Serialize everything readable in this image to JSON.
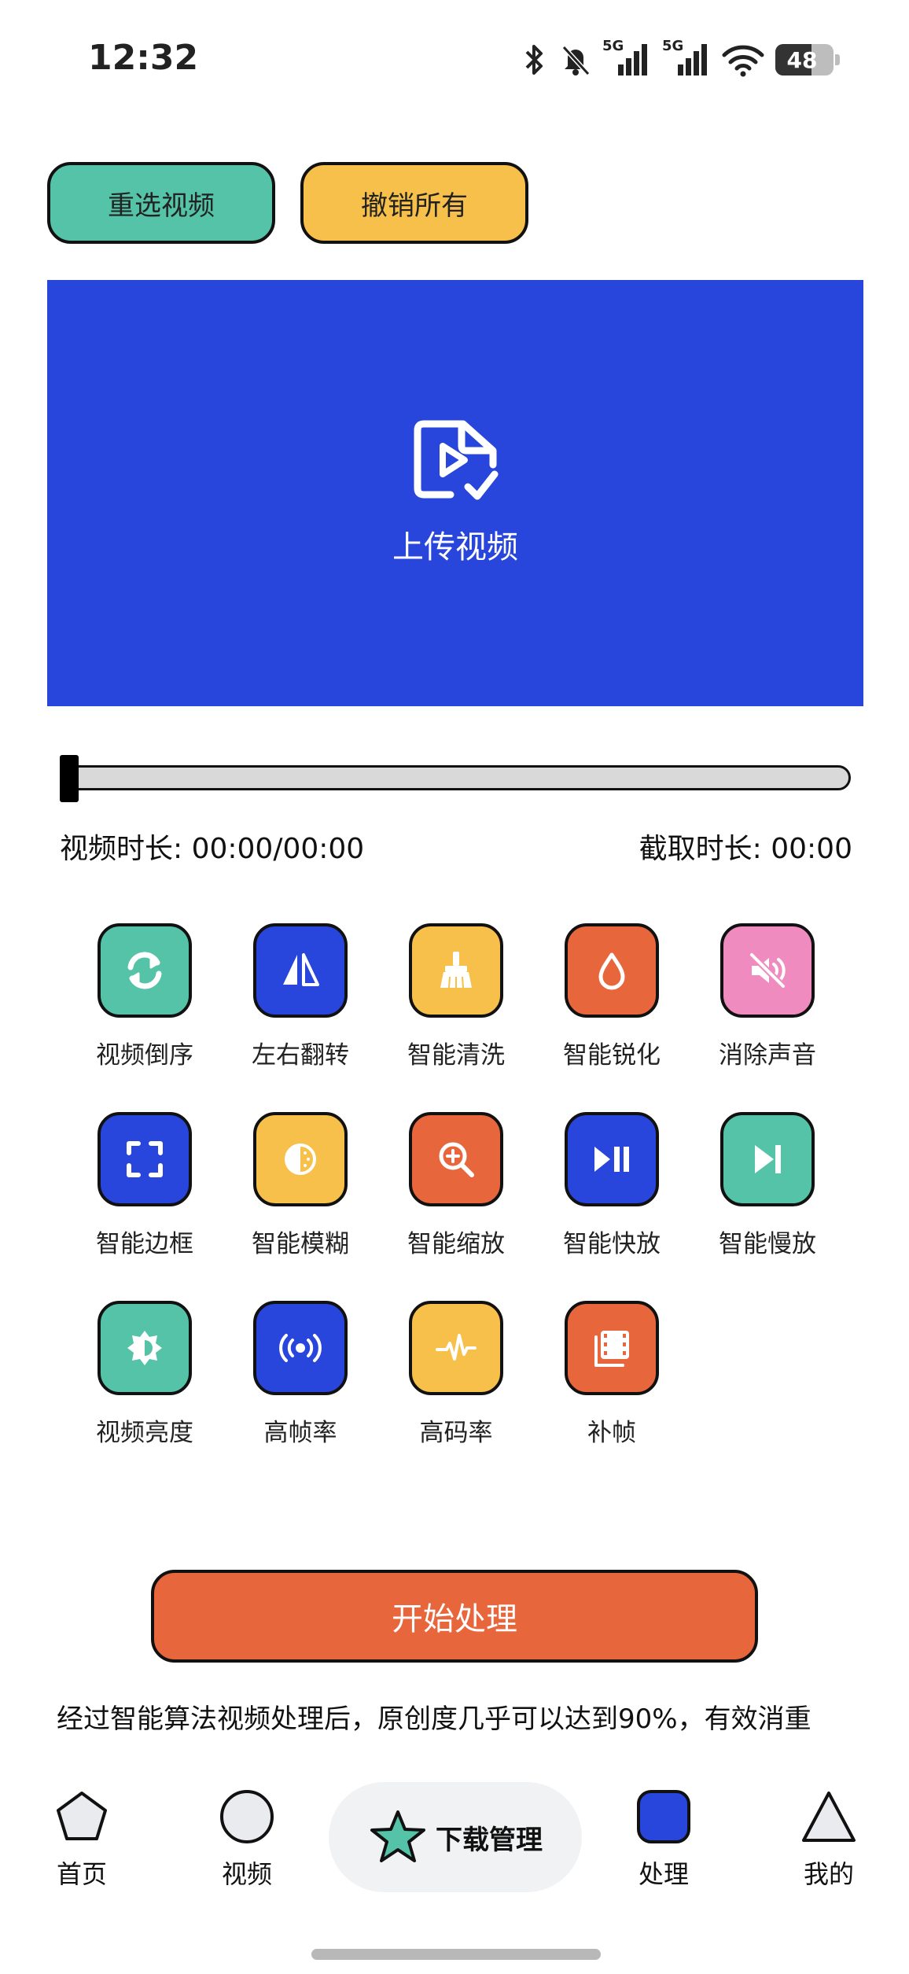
{
  "status_bar": {
    "time": "12:32",
    "battery": "48",
    "network_1": "5G",
    "network_2": "5G"
  },
  "actions": {
    "reselect": "重选视频",
    "undo_all": "撤销所有"
  },
  "upload": {
    "label": "上传视频"
  },
  "slider": {
    "position": 0
  },
  "duration": {
    "video": "视频时长: 00:00/00:00",
    "clip": "截取时长: 00:00"
  },
  "tools": [
    {
      "label": "视频倒序",
      "icon": "refresh-icon",
      "color": "#55c3a7"
    },
    {
      "label": "左右翻转",
      "icon": "flip-icon",
      "color": "#2845dc"
    },
    {
      "label": "智能清洗",
      "icon": "broom-icon",
      "color": "#f7c04a"
    },
    {
      "label": "智能锐化",
      "icon": "drop-icon",
      "color": "#e8663c"
    },
    {
      "label": "消除声音",
      "icon": "mute-icon",
      "color": "#f08bc0"
    },
    {
      "label": "智能边框",
      "icon": "frame-icon",
      "color": "#2845dc"
    },
    {
      "label": "智能模糊",
      "icon": "blur-icon",
      "color": "#f7c04a"
    },
    {
      "label": "智能缩放",
      "icon": "zoom-icon",
      "color": "#e8663c"
    },
    {
      "label": "智能快放",
      "icon": "play-pause-icon",
      "color": "#2845dc"
    },
    {
      "label": "智能慢放",
      "icon": "skip-next-icon",
      "color": "#55c3a7"
    },
    {
      "label": "视频亮度",
      "icon": "brightness-icon",
      "color": "#55c3a7"
    },
    {
      "label": "高帧率",
      "icon": "broadcast-icon",
      "color": "#2845dc"
    },
    {
      "label": "高码率",
      "icon": "waveform-icon",
      "color": "#f7c04a"
    },
    {
      "label": "补帧",
      "icon": "film-icon",
      "color": "#e8663c"
    }
  ],
  "start": {
    "label": "开始处理"
  },
  "description": "经过智能算法视频处理后，原创度几乎可以达到90%，有效消重",
  "nav": {
    "home": "首页",
    "video": "视频",
    "downloads": "下载管理",
    "process": "处理",
    "mine": "我的"
  }
}
